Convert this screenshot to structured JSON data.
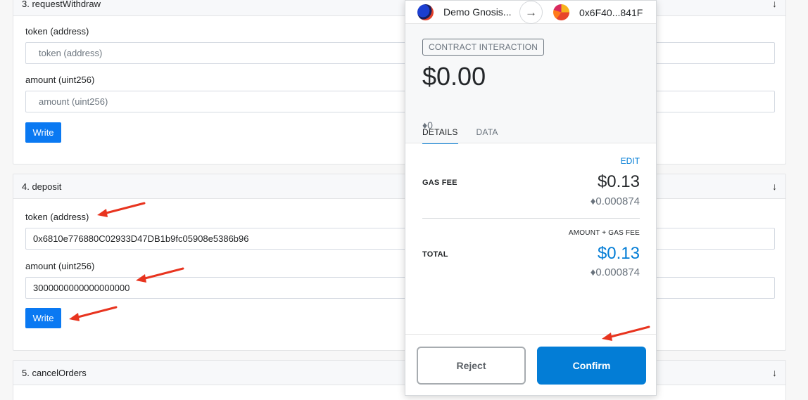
{
  "form": {
    "section3": {
      "title": "3. requestWithdraw",
      "token_label": "token (address)",
      "token_placeholder": "token (address)",
      "amount_label": "amount (uint256)",
      "amount_placeholder": "amount (uint256)",
      "write_label": "Write"
    },
    "section4": {
      "title": "4. deposit",
      "token_label": "token (address)",
      "token_value": "0x6810e776880C02933D47DB1b9fc05908e5386b96",
      "amount_label": "amount (uint256)",
      "amount_value": "3000000000000000000",
      "write_label": "Write"
    },
    "section5": {
      "title": "5. cancelOrders"
    },
    "chevron": "↓"
  },
  "metamask": {
    "from_account": "Demo Gnosis...",
    "to_account": "0x6F40...841F",
    "action_badge": "CONTRACT INTERACTION",
    "fiat_total": "$0.00",
    "eth_total": "♦0",
    "tabs": [
      "DETAILS",
      "DATA"
    ],
    "edit_label": "EDIT",
    "gas_fee_label": "GAS FEE",
    "gas_fee_fiat": "$0.13",
    "gas_fee_eth": "♦0.000874",
    "amount_gas_label": "AMOUNT + GAS FEE",
    "total_label": "TOTAL",
    "total_fiat": "$0.13",
    "total_eth": "♦0.000874",
    "reject_label": "Reject",
    "confirm_label": "Confirm",
    "colors": {
      "accent": "#037dd6",
      "write_button": "#0a79f2",
      "arrow": "#e8341f"
    }
  }
}
